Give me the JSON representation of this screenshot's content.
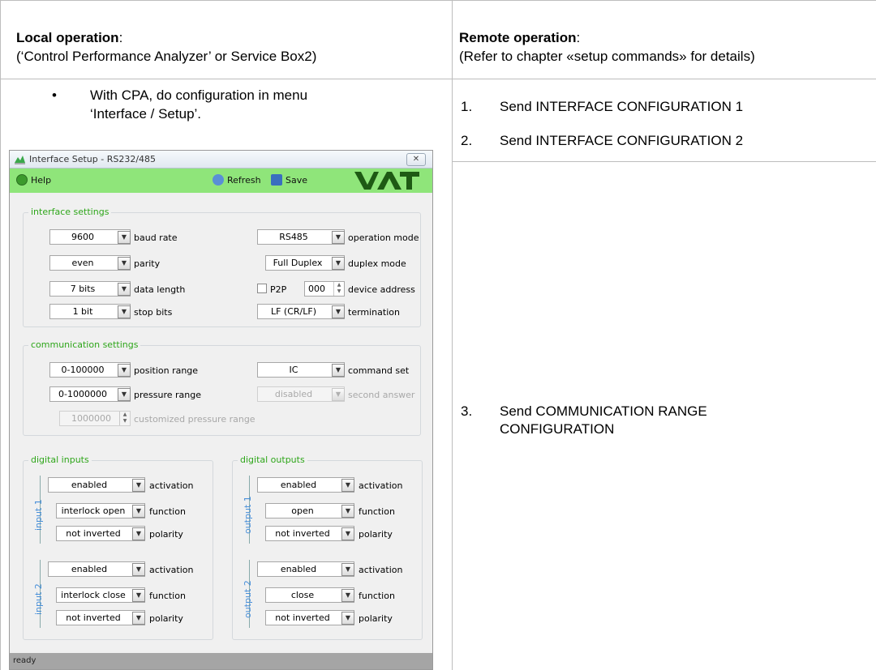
{
  "document": {
    "left_header_title": "Local operation",
    "left_header_colon": ":",
    "left_header_sub": "(‘Control Performance Analyzer’ or Service Box2)",
    "right_header_title": "Remote operation",
    "right_header_colon": ":",
    "right_header_sub": "(Refer to chapter «setup commands» for details)",
    "bullet_char": "•",
    "bullet_line1": "With CPA, do configuration in menu",
    "bullet_line2": "‘Interface / Setup’.",
    "steps": [
      {
        "num": "1.",
        "text": "Send INTERFACE CONFIGURATION 1"
      },
      {
        "num": "2.",
        "text": "Send INTERFACE CONFIGURATION 2"
      },
      {
        "num": "3.",
        "text": "Send COMMUNICATION RANGE",
        "text2": "CONFIGURATION"
      }
    ]
  },
  "dialog": {
    "title": "Interface Setup - RS232/485",
    "close_label": "✕",
    "toolbar": {
      "help": "Help",
      "refresh": "Refresh",
      "save": "Save",
      "logo": "VAT"
    },
    "interface_settings": {
      "title": "interface settings",
      "baud_rate": {
        "value": "9600",
        "label": "baud rate"
      },
      "parity": {
        "value": "even",
        "label": "parity"
      },
      "data_length": {
        "value": "7 bits",
        "label": "data length"
      },
      "stop_bits": {
        "value": "1 bit",
        "label": "stop bits"
      },
      "operation_mode": {
        "value": "RS485",
        "label": "operation mode"
      },
      "duplex_mode": {
        "value": "Full Duplex",
        "label": "duplex mode"
      },
      "p2p_label": "P2P",
      "device_address": {
        "value": "000",
        "label": "device address"
      },
      "termination": {
        "value": "LF (CR/LF)",
        "label": "termination"
      }
    },
    "communication_settings": {
      "title": "communication settings",
      "position_range": {
        "value": "0-100000",
        "label": "position range"
      },
      "pressure_range": {
        "value": "0-1000000",
        "label": "pressure range"
      },
      "customized_pressure_range": {
        "value": "1000000",
        "label": "customized pressure range"
      },
      "command_set": {
        "value": "IC",
        "label": "command set"
      },
      "second_answer": {
        "value": "disabled",
        "label": "second answer"
      }
    },
    "digital_inputs": {
      "title": "digital inputs",
      "input1": {
        "name": "input 1",
        "activation": "enabled",
        "function": "interlock open",
        "polarity": "not inverted"
      },
      "input2": {
        "name": "input 2",
        "activation": "enabled",
        "function": "interlock close",
        "polarity": "not inverted"
      },
      "labels": {
        "activation": "activation",
        "function": "function",
        "polarity": "polarity"
      }
    },
    "digital_outputs": {
      "title": "digital outputs",
      "output1": {
        "name": "output 1",
        "activation": "enabled",
        "function": "open",
        "polarity": "not inverted"
      },
      "output2": {
        "name": "output 2",
        "activation": "enabled",
        "function": "close",
        "polarity": "not inverted"
      },
      "labels": {
        "activation": "activation",
        "function": "function",
        "polarity": "polarity"
      }
    },
    "status": "ready",
    "colors": {
      "toolbar": "#8fe57a",
      "group_title": "#2ea61a",
      "io_label": "#4a90d9",
      "statusbar": "#a5a5a5"
    }
  }
}
